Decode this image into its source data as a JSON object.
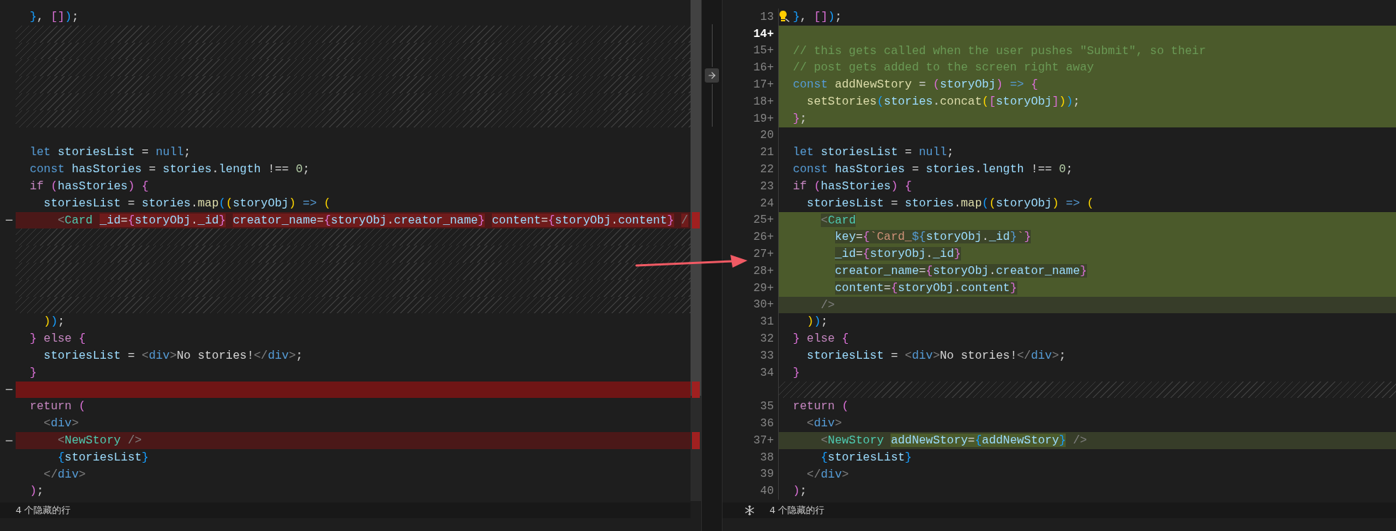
{
  "left_editor": {
    "rows": [
      {
        "kind": "context",
        "tokens": [
          {
            "kind": "b3",
            "text": "  }"
          },
          {
            "kind": "plain",
            "text": ", "
          },
          {
            "kind": "b2",
            "text": "[]"
          },
          {
            "kind": "b3",
            "text": ")"
          },
          {
            "kind": "plain",
            "text": ";"
          }
        ]
      },
      {
        "kind": "filler"
      },
      {
        "kind": "filler"
      },
      {
        "kind": "filler"
      },
      {
        "kind": "filler"
      },
      {
        "kind": "filler"
      },
      {
        "kind": "filler"
      },
      {
        "kind": "context",
        "tokens": []
      },
      {
        "kind": "context",
        "tokens": [
          {
            "kind": "keyword",
            "text": "  let"
          },
          {
            "kind": "var",
            "text": " storiesList"
          },
          {
            "kind": "plain",
            "text": " = "
          },
          {
            "kind": "keyword",
            "text": "null"
          },
          {
            "kind": "plain",
            "text": ";"
          }
        ]
      },
      {
        "kind": "context",
        "tokens": [
          {
            "kind": "keyword",
            "text": "  const"
          },
          {
            "kind": "var",
            "text": " hasStories"
          },
          {
            "kind": "plain",
            "text": " = "
          },
          {
            "kind": "var",
            "text": "stories"
          },
          {
            "kind": "plain",
            "text": "."
          },
          {
            "kind": "var",
            "text": "length"
          },
          {
            "kind": "plain",
            "text": " !== "
          },
          {
            "kind": "num",
            "text": "0"
          },
          {
            "kind": "plain",
            "text": ";"
          }
        ]
      },
      {
        "kind": "context",
        "tokens": [
          {
            "kind": "control",
            "text": "  if"
          },
          {
            "kind": "b2",
            "text": " ("
          },
          {
            "kind": "var",
            "text": "hasStories"
          },
          {
            "kind": "b2",
            "text": ")"
          },
          {
            "kind": "b2",
            "text": " {"
          }
        ]
      },
      {
        "kind": "context",
        "tokens": [
          {
            "kind": "var",
            "text": "    storiesList"
          },
          {
            "kind": "plain",
            "text": " = "
          },
          {
            "kind": "var",
            "text": "stories"
          },
          {
            "kind": "plain",
            "text": "."
          },
          {
            "kind": "fn",
            "text": "map"
          },
          {
            "kind": "b3",
            "text": "("
          },
          {
            "kind": "b1",
            "text": "("
          },
          {
            "kind": "var",
            "text": "storyObj"
          },
          {
            "kind": "b1",
            "text": ")"
          },
          {
            "kind": "keyword",
            "text": " =>"
          },
          {
            "kind": "b1",
            "text": " ("
          }
        ]
      },
      {
        "kind": "removed",
        "marker": "−",
        "tokens": [
          {
            "kind": "tag",
            "text": "      <"
          },
          {
            "kind": "comp",
            "text": "Card"
          },
          {
            "kind": "var",
            "text": " _id",
            "hl": true
          },
          {
            "kind": "plain",
            "text": "=",
            "hl": true
          },
          {
            "kind": "b2",
            "text": "{",
            "hl": true
          },
          {
            "kind": "var",
            "text": "storyObj",
            "hl": true
          },
          {
            "kind": "plain",
            "text": ".",
            "hl": true
          },
          {
            "kind": "var",
            "text": "_id",
            "hl": true
          },
          {
            "kind": "b2",
            "text": "}",
            "hl": true
          },
          {
            "kind": "var",
            "text": " creator_name",
            "hl": true
          },
          {
            "kind": "plain",
            "text": "=",
            "hl": true
          },
          {
            "kind": "b2",
            "text": "{",
            "hl": true
          },
          {
            "kind": "var",
            "text": "storyObj",
            "hl": true
          },
          {
            "kind": "plain",
            "text": ".",
            "hl": true
          },
          {
            "kind": "var",
            "text": "creator_name",
            "hl": true
          },
          {
            "kind": "b2",
            "text": "}",
            "hl": true
          },
          {
            "kind": "var",
            "text": " content",
            "hl": true
          },
          {
            "kind": "plain",
            "text": "=",
            "hl": true
          },
          {
            "kind": "b2",
            "text": "{",
            "hl": true
          },
          {
            "kind": "var",
            "text": "storyObj",
            "hl": true
          },
          {
            "kind": "plain",
            "text": ".",
            "hl": true
          },
          {
            "kind": "var",
            "text": "content",
            "hl": true
          },
          {
            "kind": "b2",
            "text": "}",
            "hl": true
          },
          {
            "kind": "tag",
            "text": " /",
            "hl": true
          }
        ]
      },
      {
        "kind": "filler"
      },
      {
        "kind": "filler"
      },
      {
        "kind": "filler"
      },
      {
        "kind": "filler"
      },
      {
        "kind": "filler"
      },
      {
        "kind": "context",
        "tokens": [
          {
            "kind": "b1",
            "text": "    )"
          },
          {
            "kind": "b3",
            "text": ")"
          },
          {
            "kind": "plain",
            "text": ";"
          }
        ]
      },
      {
        "kind": "context",
        "tokens": [
          {
            "kind": "b2",
            "text": "  }"
          },
          {
            "kind": "control",
            "text": " else"
          },
          {
            "kind": "b2",
            "text": " {"
          }
        ]
      },
      {
        "kind": "context",
        "tokens": [
          {
            "kind": "var",
            "text": "    storiesList"
          },
          {
            "kind": "plain",
            "text": " = "
          },
          {
            "kind": "tag",
            "text": "<"
          },
          {
            "kind": "tagname",
            "text": "div"
          },
          {
            "kind": "tag",
            "text": ">"
          },
          {
            "kind": "plain",
            "text": "No stories!"
          },
          {
            "kind": "tag",
            "text": "</"
          },
          {
            "kind": "tagname",
            "text": "div"
          },
          {
            "kind": "tag",
            "text": ">"
          },
          {
            "kind": "plain",
            "text": ";"
          }
        ]
      },
      {
        "kind": "context",
        "tokens": [
          {
            "kind": "b2",
            "text": "  }"
          }
        ]
      },
      {
        "kind": "removed_strong",
        "marker": "−",
        "tokens": []
      },
      {
        "kind": "context",
        "tokens": [
          {
            "kind": "control",
            "text": "  return"
          },
          {
            "kind": "b2",
            "text": " ("
          }
        ]
      },
      {
        "kind": "context",
        "tokens": [
          {
            "kind": "tag",
            "text": "    <"
          },
          {
            "kind": "tagname",
            "text": "div"
          },
          {
            "kind": "tag",
            "text": ">"
          }
        ]
      },
      {
        "kind": "removed",
        "marker": "−",
        "tokens": [
          {
            "kind": "tag",
            "text": "      <"
          },
          {
            "kind": "comp",
            "text": "NewStory"
          },
          {
            "kind": "tag",
            "text": " />"
          }
        ]
      },
      {
        "kind": "context",
        "tokens": [
          {
            "kind": "b3",
            "text": "      {"
          },
          {
            "kind": "var",
            "text": "storiesList"
          },
          {
            "kind": "b3",
            "text": "}"
          }
        ]
      },
      {
        "kind": "context",
        "tokens": [
          {
            "kind": "tag",
            "text": "    </"
          },
          {
            "kind": "tagname",
            "text": "div"
          },
          {
            "kind": "tag",
            "text": ">"
          }
        ]
      },
      {
        "kind": "context",
        "tokens": [
          {
            "kind": "b2",
            "text": "  )"
          },
          {
            "kind": "plain",
            "text": ";"
          }
        ]
      }
    ],
    "hidden_lines_label": "4 个隐藏的行"
  },
  "right_editor": {
    "rows": [
      {
        "kind": "context",
        "line": "13",
        "current": false,
        "lightbulb": true,
        "tokens": [
          {
            "kind": "b3",
            "text": "  }"
          },
          {
            "kind": "plain",
            "text": ", "
          },
          {
            "kind": "b2",
            "text": "[]"
          },
          {
            "kind": "b3",
            "text": ")"
          },
          {
            "kind": "plain",
            "text": ";"
          }
        ]
      },
      {
        "kind": "added",
        "line": "14+",
        "current": true,
        "tokens": []
      },
      {
        "kind": "added",
        "line": "15+",
        "current": false,
        "tokens": [
          {
            "kind": "comment",
            "text": "  // this gets called when the user pushes \"Submit\", so their"
          }
        ]
      },
      {
        "kind": "added",
        "line": "16+",
        "current": false,
        "tokens": [
          {
            "kind": "comment",
            "text": "  // post gets added to the screen right away"
          }
        ]
      },
      {
        "kind": "added",
        "line": "17+",
        "current": false,
        "tokens": [
          {
            "kind": "keyword",
            "text": "  const"
          },
          {
            "kind": "fn",
            "text": " addNewStory"
          },
          {
            "kind": "plain",
            "text": " = "
          },
          {
            "kind": "b2",
            "text": "("
          },
          {
            "kind": "var",
            "text": "storyObj"
          },
          {
            "kind": "b2",
            "text": ")"
          },
          {
            "kind": "keyword",
            "text": " =>"
          },
          {
            "kind": "b2",
            "text": " {"
          }
        ]
      },
      {
        "kind": "added",
        "line": "18+",
        "current": false,
        "tokens": [
          {
            "kind": "fn",
            "text": "    setStories"
          },
          {
            "kind": "b3",
            "text": "("
          },
          {
            "kind": "var",
            "text": "stories"
          },
          {
            "kind": "plain",
            "text": "."
          },
          {
            "kind": "fn",
            "text": "concat"
          },
          {
            "kind": "b1",
            "text": "("
          },
          {
            "kind": "b2",
            "text": "["
          },
          {
            "kind": "var",
            "text": "storyObj"
          },
          {
            "kind": "b2",
            "text": "]"
          },
          {
            "kind": "b1",
            "text": ")"
          },
          {
            "kind": "b3",
            "text": ")"
          },
          {
            "kind": "plain",
            "text": ";"
          }
        ]
      },
      {
        "kind": "added",
        "line": "19+",
        "current": false,
        "tokens": [
          {
            "kind": "b2",
            "text": "  }"
          },
          {
            "kind": "plain",
            "text": ";"
          }
        ]
      },
      {
        "kind": "context",
        "line": "20",
        "current": false,
        "tokens": []
      },
      {
        "kind": "context",
        "line": "21",
        "current": false,
        "tokens": [
          {
            "kind": "keyword",
            "text": "  let"
          },
          {
            "kind": "var",
            "text": " storiesList"
          },
          {
            "kind": "plain",
            "text": " = "
          },
          {
            "kind": "keyword",
            "text": "null"
          },
          {
            "kind": "plain",
            "text": ";"
          }
        ]
      },
      {
        "kind": "context",
        "line": "22",
        "current": false,
        "tokens": [
          {
            "kind": "keyword",
            "text": "  const"
          },
          {
            "kind": "var",
            "text": " hasStories"
          },
          {
            "kind": "plain",
            "text": " = "
          },
          {
            "kind": "var",
            "text": "stories"
          },
          {
            "kind": "plain",
            "text": "."
          },
          {
            "kind": "var",
            "text": "length"
          },
          {
            "kind": "plain",
            "text": " !== "
          },
          {
            "kind": "num",
            "text": "0"
          },
          {
            "kind": "plain",
            "text": ";"
          }
        ]
      },
      {
        "kind": "context",
        "line": "23",
        "current": false,
        "tokens": [
          {
            "kind": "control",
            "text": "  if"
          },
          {
            "kind": "b2",
            "text": " ("
          },
          {
            "kind": "var",
            "text": "hasStories"
          },
          {
            "kind": "b2",
            "text": ")"
          },
          {
            "kind": "b2",
            "text": " {"
          }
        ]
      },
      {
        "kind": "context",
        "line": "24",
        "current": false,
        "tokens": [
          {
            "kind": "var",
            "text": "    storiesList"
          },
          {
            "kind": "plain",
            "text": " = "
          },
          {
            "kind": "var",
            "text": "stories"
          },
          {
            "kind": "plain",
            "text": "."
          },
          {
            "kind": "fn",
            "text": "map"
          },
          {
            "kind": "b3",
            "text": "("
          },
          {
            "kind": "b1",
            "text": "("
          },
          {
            "kind": "var",
            "text": "storyObj"
          },
          {
            "kind": "b1",
            "text": ")"
          },
          {
            "kind": "keyword",
            "text": " =>"
          },
          {
            "kind": "b1",
            "text": " ("
          }
        ]
      },
      {
        "kind": "added",
        "line": "25+",
        "current": false,
        "tokens": [
          {
            "kind": "tag",
            "text": "      <",
            "hl": true
          },
          {
            "kind": "comp",
            "text": "Card",
            "hl": true
          }
        ]
      },
      {
        "kind": "added",
        "line": "26+",
        "current": false,
        "tokens": [
          {
            "kind": "var",
            "text": "        key",
            "hl": true
          },
          {
            "kind": "plain",
            "text": "=",
            "hl": true
          },
          {
            "kind": "b2",
            "text": "{",
            "hl": true
          },
          {
            "kind": "str",
            "text": "`Card_",
            "hl": true
          },
          {
            "kind": "keyword",
            "text": "${",
            "hl": true
          },
          {
            "kind": "var",
            "text": "storyObj",
            "hl": true
          },
          {
            "kind": "plain",
            "text": ".",
            "hl": true
          },
          {
            "kind": "var",
            "text": "_id",
            "hl": true
          },
          {
            "kind": "keyword",
            "text": "}",
            "hl": true
          },
          {
            "kind": "str",
            "text": "`",
            "hl": true
          },
          {
            "kind": "b2",
            "text": "}",
            "hl": true
          }
        ]
      },
      {
        "kind": "added",
        "line": "27+",
        "current": false,
        "tokens": [
          {
            "kind": "var",
            "text": "        _id",
            "hl": true
          },
          {
            "kind": "plain",
            "text": "=",
            "hl": true
          },
          {
            "kind": "b2",
            "text": "{",
            "hl": true
          },
          {
            "kind": "var",
            "text": "storyObj",
            "hl": true
          },
          {
            "kind": "plain",
            "text": ".",
            "hl": true
          },
          {
            "kind": "var",
            "text": "_id",
            "hl": true
          },
          {
            "kind": "b2",
            "text": "}",
            "hl": true
          }
        ]
      },
      {
        "kind": "added",
        "line": "28+",
        "current": false,
        "tokens": [
          {
            "kind": "var",
            "text": "        creator_name",
            "hl": true
          },
          {
            "kind": "plain",
            "text": "=",
            "hl": true
          },
          {
            "kind": "b2",
            "text": "{",
            "hl": true
          },
          {
            "kind": "var",
            "text": "storyObj",
            "hl": true
          },
          {
            "kind": "plain",
            "text": ".",
            "hl": true
          },
          {
            "kind": "var",
            "text": "creator_name",
            "hl": true
          },
          {
            "kind": "b2",
            "text": "}",
            "hl": true
          }
        ]
      },
      {
        "kind": "added",
        "line": "29+",
        "current": false,
        "tokens": [
          {
            "kind": "var",
            "text": "        content",
            "hl": true
          },
          {
            "kind": "plain",
            "text": "=",
            "hl": true
          },
          {
            "kind": "b2",
            "text": "{",
            "hl": true
          },
          {
            "kind": "var",
            "text": "storyObj",
            "hl": true
          },
          {
            "kind": "plain",
            "text": ".",
            "hl": true
          },
          {
            "kind": "var",
            "text": "content",
            "hl": true
          },
          {
            "kind": "b2",
            "text": "}",
            "hl": true
          }
        ]
      },
      {
        "kind": "added_weak",
        "line": "30+",
        "current": false,
        "tokens": [
          {
            "kind": "tag",
            "text": "      />"
          }
        ]
      },
      {
        "kind": "context",
        "line": "31",
        "current": false,
        "tokens": [
          {
            "kind": "b1",
            "text": "    )"
          },
          {
            "kind": "b3",
            "text": ")"
          },
          {
            "kind": "plain",
            "text": ";"
          }
        ]
      },
      {
        "kind": "context",
        "line": "32",
        "current": false,
        "tokens": [
          {
            "kind": "b2",
            "text": "  }"
          },
          {
            "kind": "control",
            "text": " else"
          },
          {
            "kind": "b2",
            "text": " {"
          }
        ]
      },
      {
        "kind": "context",
        "line": "33",
        "current": false,
        "tokens": [
          {
            "kind": "var",
            "text": "    storiesList"
          },
          {
            "kind": "plain",
            "text": " = "
          },
          {
            "kind": "tag",
            "text": "<"
          },
          {
            "kind": "tagname",
            "text": "div"
          },
          {
            "kind": "tag",
            "text": ">"
          },
          {
            "kind": "plain",
            "text": "No stories!"
          },
          {
            "kind": "tag",
            "text": "</"
          },
          {
            "kind": "tagname",
            "text": "div"
          },
          {
            "kind": "tag",
            "text": ">"
          },
          {
            "kind": "plain",
            "text": ";"
          }
        ]
      },
      {
        "kind": "context",
        "line": "34",
        "current": false,
        "tokens": [
          {
            "kind": "b2",
            "text": "  }"
          }
        ]
      },
      {
        "kind": "filler"
      },
      {
        "kind": "context",
        "line": "35",
        "current": false,
        "tokens": [
          {
            "kind": "control",
            "text": "  return"
          },
          {
            "kind": "b2",
            "text": " ("
          }
        ]
      },
      {
        "kind": "context",
        "line": "36",
        "current": false,
        "tokens": [
          {
            "kind": "tag",
            "text": "    <"
          },
          {
            "kind": "tagname",
            "text": "div"
          },
          {
            "kind": "tag",
            "text": ">"
          }
        ]
      },
      {
        "kind": "added_weak",
        "line": "37+",
        "current": false,
        "tokens": [
          {
            "kind": "tag",
            "text": "      <"
          },
          {
            "kind": "comp",
            "text": "NewStory"
          },
          {
            "kind": "var",
            "text": " addNewStory",
            "hl": true
          },
          {
            "kind": "plain",
            "text": "=",
            "hl": true
          },
          {
            "kind": "b3",
            "text": "{",
            "hl": true
          },
          {
            "kind": "var",
            "text": "addNewStory",
            "hl": true
          },
          {
            "kind": "b3",
            "text": "}",
            "hl": true
          },
          {
            "kind": "tag",
            "text": " />"
          }
        ]
      },
      {
        "kind": "context",
        "line": "38",
        "current": false,
        "tokens": [
          {
            "kind": "b3",
            "text": "      {"
          },
          {
            "kind": "var",
            "text": "storiesList"
          },
          {
            "kind": "b3",
            "text": "}"
          }
        ]
      },
      {
        "kind": "context",
        "line": "39",
        "current": false,
        "tokens": [
          {
            "kind": "tag",
            "text": "    </"
          },
          {
            "kind": "tagname",
            "text": "div"
          },
          {
            "kind": "tag",
            "text": ">"
          }
        ]
      },
      {
        "kind": "context",
        "line": "40",
        "current": false,
        "tokens": [
          {
            "kind": "b2",
            "text": "  )"
          },
          {
            "kind": "plain",
            "text": ";"
          }
        ]
      }
    ],
    "hidden_lines_label": "4 个隐藏的行"
  }
}
